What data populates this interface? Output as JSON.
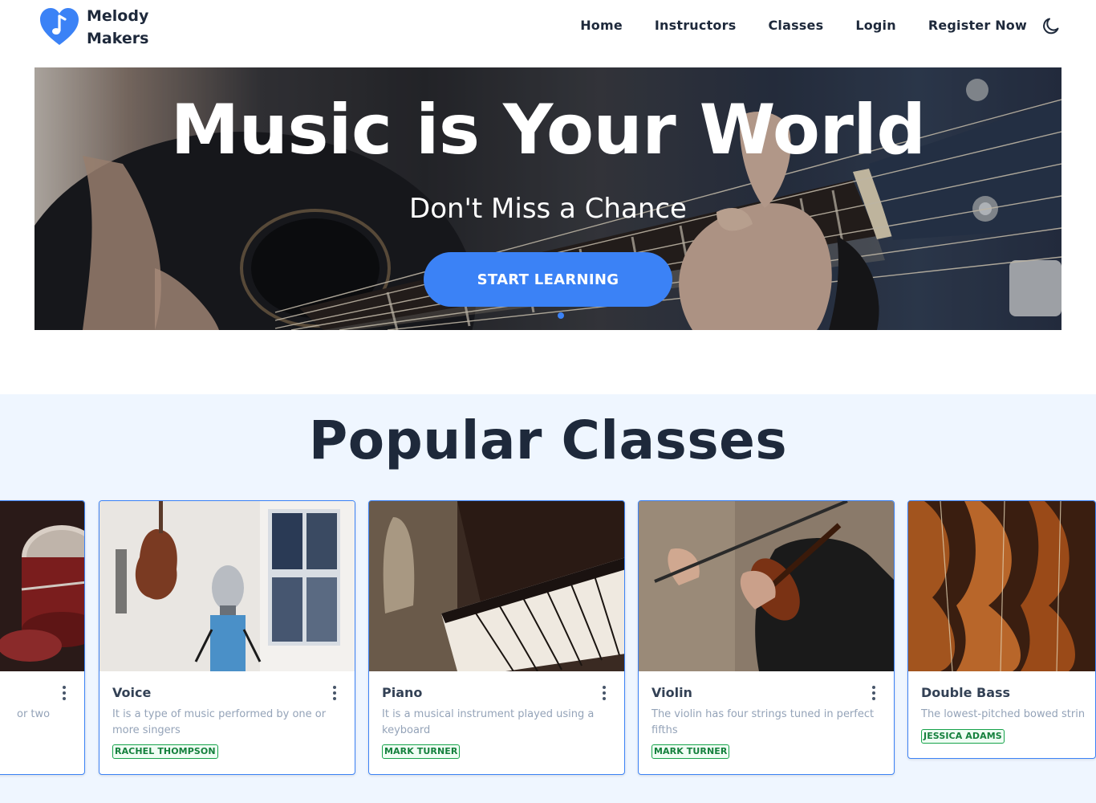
{
  "brand": {
    "line1": "Melody",
    "line2": "Makers",
    "logo": "heart-music-note-icon",
    "accent": "#3b82f6"
  },
  "nav": {
    "items": [
      "Home",
      "Instructors",
      "Classes",
      "Login",
      "Register Now"
    ],
    "theme_toggle": "moon-icon"
  },
  "hero": {
    "title": "Music is Your World",
    "subtitle": "Don't Miss a Chance",
    "cta": "START LEARNING",
    "image": "acoustic-guitar-photo",
    "carousel_active": 1
  },
  "popular": {
    "title": "Popular Classes",
    "cards": [
      {
        "name": "",
        "desc": "or two",
        "instructor": "",
        "image": "drums-photo"
      },
      {
        "name": "Voice",
        "desc": "It is a type of music performed by one or more singers",
        "instructor": "RACHEL THOMPSON",
        "image": "microphone-photo"
      },
      {
        "name": "Piano",
        "desc": "It is a musical instrument played using a keyboard",
        "instructor": "MARK TURNER",
        "image": "piano-photo"
      },
      {
        "name": "Violin",
        "desc": "The violin has four strings tuned in perfect fifths",
        "instructor": "MARK TURNER",
        "image": "violin-photo"
      },
      {
        "name": "Double Bass",
        "desc": "The lowest-pitched bowed strin",
        "instructor": "JESSICA ADAMS",
        "image": "double-bass-photo"
      }
    ]
  },
  "colors": {
    "primary": "#3b82f6",
    "section_bg": "#eff6ff",
    "tag_green": "#15803d",
    "heading": "#1e293b"
  }
}
